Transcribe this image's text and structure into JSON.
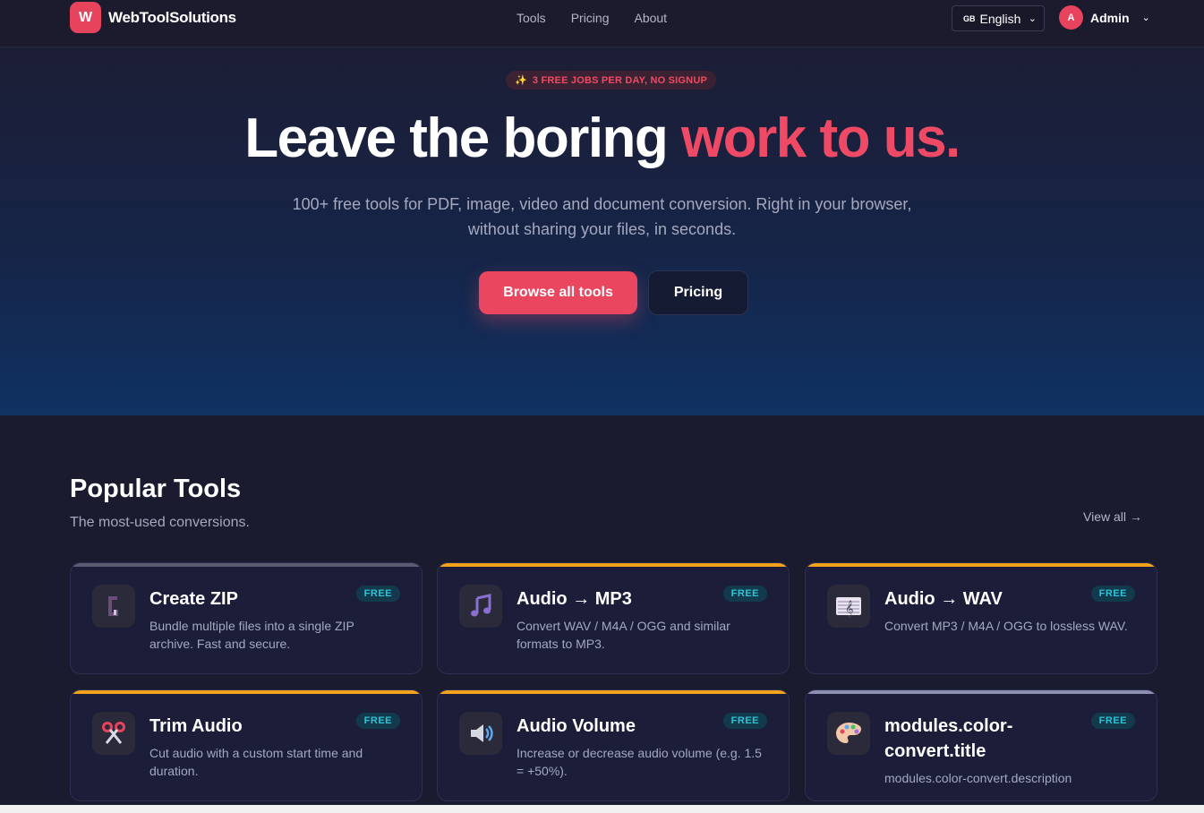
{
  "nav": {
    "logo_letter": "W",
    "brand": "WebToolSolutions",
    "links": [
      "Tools",
      "Pricing",
      "About"
    ],
    "language": {
      "flag": "GB",
      "label": "English"
    },
    "user": {
      "initial": "A",
      "name": "Admin"
    }
  },
  "hero": {
    "badge": "3 FREE JOBS PER DAY, NO SIGNUP",
    "title_main": "Leave the boring ",
    "title_accent": "work to us.",
    "subtitle": "100+ free tools for PDF, image, video and document conversion. Right in your browser, without sharing your files, in seconds.",
    "primary_button": "Browse all tools",
    "secondary_button": "Pricing"
  },
  "popular": {
    "title": "Popular Tools",
    "subtitle": "The most-used conversions.",
    "view_all": "View all →",
    "cards": [
      {
        "title": "Create ZIP",
        "badge": "FREE",
        "description": "Bundle multiple files into a single ZIP archive. Fast and secure.",
        "icon": "clamp-icon",
        "accent": "#5a5d72"
      },
      {
        "title": "Audio → MP3",
        "badge": "FREE",
        "description": "Convert WAV / M4A / OGG and similar formats to MP3.",
        "icon": "music-note-icon",
        "accent": "#f3a21c"
      },
      {
        "title": "Audio → WAV",
        "badge": "FREE",
        "description": "Convert MP3 / M4A / OGG to lossless WAV.",
        "icon": "treble-clef-icon",
        "accent": "#f3a21c"
      },
      {
        "title": "Trim Audio",
        "badge": "FREE",
        "description": "Cut audio with a custom start time and duration.",
        "icon": "scissors-icon",
        "accent": "#f3a21c"
      },
      {
        "title": "Audio Volume",
        "badge": "FREE",
        "description": "Increase or decrease audio volume (e.g. 1.5 = +50%).",
        "icon": "speaker-icon",
        "accent": "#f3a21c"
      },
      {
        "title": "modules.color-convert.title",
        "badge": "FREE",
        "description": "modules.color-convert.description",
        "icon": "palette-icon",
        "accent": "#8d8fb3"
      }
    ]
  }
}
